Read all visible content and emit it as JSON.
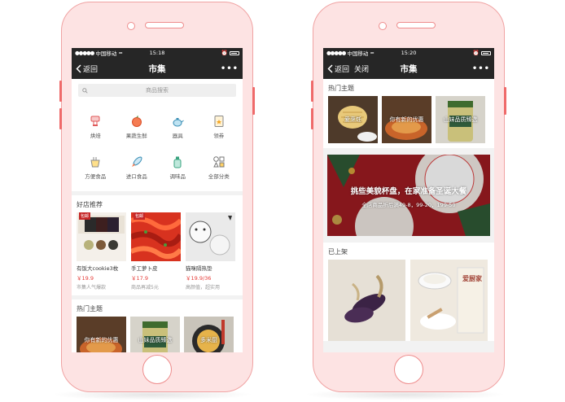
{
  "left_phone": {
    "status": {
      "carrier": "中国移动",
      "time": "15:18"
    },
    "nav": {
      "back_label": "返回",
      "title": "市集",
      "more_label": "•••"
    },
    "search": {
      "placeholder": "商品搜索",
      "icon": "search-icon"
    },
    "categories": [
      {
        "label": "烘焙",
        "icon": "baking-mixer-icon"
      },
      {
        "label": "果蔬生鲜",
        "icon": "apple-icon"
      },
      {
        "label": "器具",
        "icon": "teapot-icon"
      },
      {
        "label": "领券",
        "icon": "coupon-icon"
      },
      {
        "label": "方便食品",
        "icon": "instant-food-icon"
      },
      {
        "label": "进口食品",
        "icon": "rocket-icon"
      },
      {
        "label": "调味品",
        "icon": "condiment-bottle-icon"
      },
      {
        "label": "全部分类",
        "icon": "all-categories-icon"
      }
    ],
    "good_shops": {
      "title": "好店推荐",
      "items": [
        {
          "name": "有饭大cookie3枚",
          "price": "￥19.9",
          "note": "市集人气爆款",
          "badge": "包邮"
        },
        {
          "name": "手工萝卜皮",
          "price": "￥17.9",
          "note": "商品再减5元",
          "badge": "包邮"
        },
        {
          "name": "猫咪隔热垫",
          "price": "￥19.9/36",
          "note": "高颜值，超实用"
        }
      ]
    },
    "hot_topics": {
      "title": "热门主题",
      "items": [
        {
          "caption": "你有新的优惠"
        },
        {
          "caption": "山妹品质臻选"
        },
        {
          "caption": "多米厨"
        }
      ]
    }
  },
  "right_phone": {
    "status": {
      "carrier": "中国移动",
      "time": "15:20"
    },
    "nav": {
      "back_label": "返回",
      "close_label": "关闭",
      "title": "市集",
      "more_label": "•••"
    },
    "hot_topics": {
      "title": "热门主题",
      "items": [
        {
          "caption": "爱烹饪"
        },
        {
          "caption": "你有新的优惠"
        },
        {
          "caption": "山妹品质臻选"
        }
      ]
    },
    "banner": {
      "title": "挑些美貌杯盘，在家准备圣诞大餐",
      "subtitle": "全店商品折后满49-8，99-20，199-50"
    },
    "shelf": {
      "title": "已上架",
      "items": [
        {
          "name": "purple-corn-product"
        },
        {
          "name": "rice-flour-product",
          "label": "爱厨家"
        }
      ]
    }
  },
  "colors": {
    "phone_frame": "#f0a3a3",
    "phone_body": "#fde3e3",
    "accent_red": "#e53935",
    "navbar": "#262626"
  }
}
